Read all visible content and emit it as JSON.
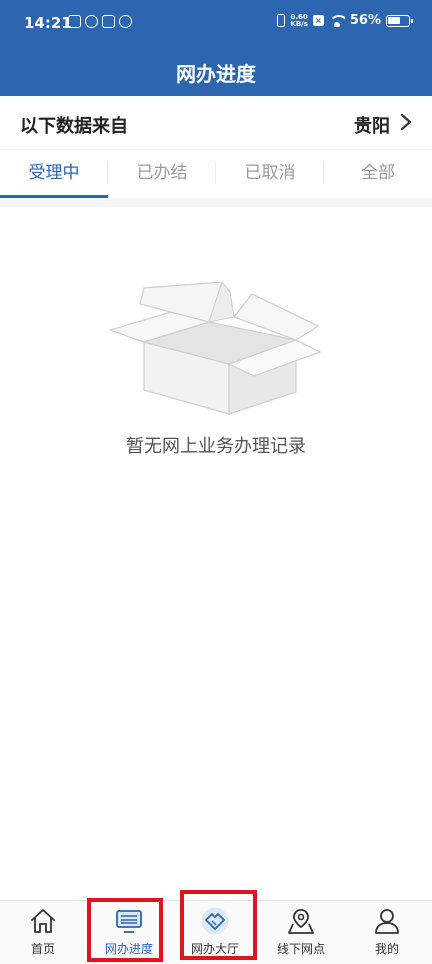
{
  "status_bar": {
    "time": "14:21",
    "net_speed_value": "0.60",
    "net_speed_unit": "KB/s",
    "battery": "56%"
  },
  "header": {
    "title": "网办进度"
  },
  "source": {
    "label": "以下数据来自",
    "city": "贵阳"
  },
  "tabs": [
    {
      "label": "受理中",
      "active": true
    },
    {
      "label": "已办结",
      "active": false
    },
    {
      "label": "已取消",
      "active": false
    },
    {
      "label": "全部",
      "active": false
    }
  ],
  "empty_state": {
    "message": "暂无网上业务办理记录"
  },
  "tab_bar": [
    {
      "label": "首页",
      "icon": "home-icon"
    },
    {
      "label": "网办进度",
      "icon": "monitor-icon",
      "active": true
    },
    {
      "label": "网办大厅",
      "icon": "handshake-icon"
    },
    {
      "label": "线下网点",
      "icon": "map-pin-icon"
    },
    {
      "label": "我的",
      "icon": "user-icon"
    }
  ],
  "colors": {
    "primary": "#2c66b0",
    "highlight": "#e0141e"
  }
}
